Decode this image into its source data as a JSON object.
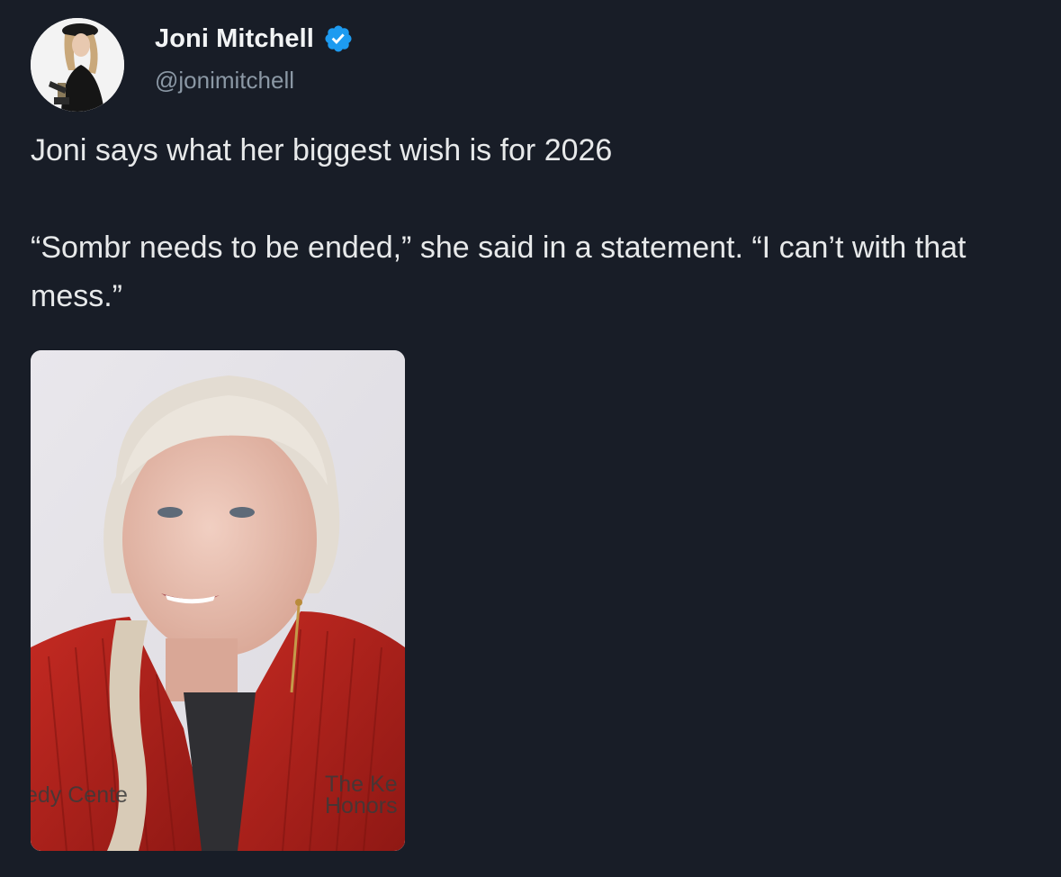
{
  "author": {
    "display_name": "Joni Mitchell",
    "handle": "@jonimitchell",
    "verified": true,
    "verified_color": "#1d9bf0",
    "avatar_icon": "avatar-photo"
  },
  "tweet": {
    "line1": "Joni says what her biggest wish is for 2026",
    "line2": "“Sombr needs to be ended,” she said in a statement. “I can’t with that mess.”"
  },
  "media": {
    "backdrop_left": "edy Cente",
    "backdrop_right_1": "The Ke",
    "backdrop_right_2": "Honors"
  },
  "colors": {
    "background": "#181d27",
    "text_primary": "#e7e9ea",
    "text_secondary": "#8b98a5",
    "jacket_red": "#b8231e"
  }
}
